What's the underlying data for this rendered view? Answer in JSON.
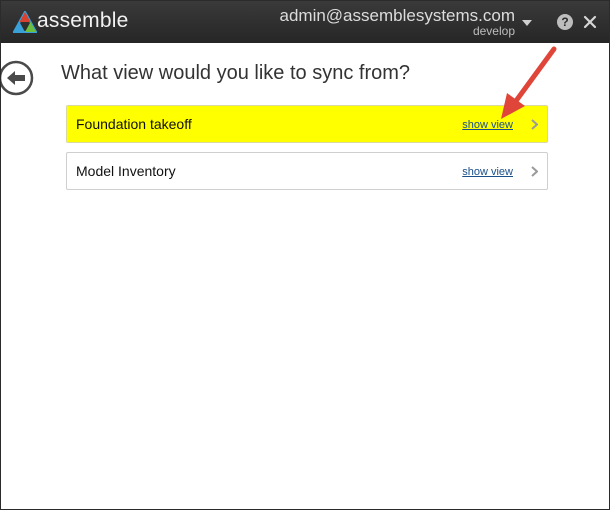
{
  "app": {
    "logo_text": "assemble",
    "user_email": "admin@assemblesystems.com",
    "environment": "develop"
  },
  "icons": {
    "logo": "assemble-triangle-logo",
    "caret": "chevron-down-icon",
    "help": "help-icon",
    "help_glyph": "?",
    "close": "close-icon",
    "back": "back-arrow-icon",
    "chevron": "chevron-right-icon"
  },
  "page": {
    "title": "What view would you like to sync from?"
  },
  "views": [
    {
      "label": "Foundation takeoff",
      "link": "show view",
      "highlighted": true
    },
    {
      "label": "Model Inventory",
      "link": "show view",
      "highlighted": false
    }
  ],
  "colors": {
    "titlebar": "#2e2e2e",
    "highlight": "#ffff00",
    "link": "#1a4f8a",
    "annotation_arrow": "#e0453a"
  }
}
